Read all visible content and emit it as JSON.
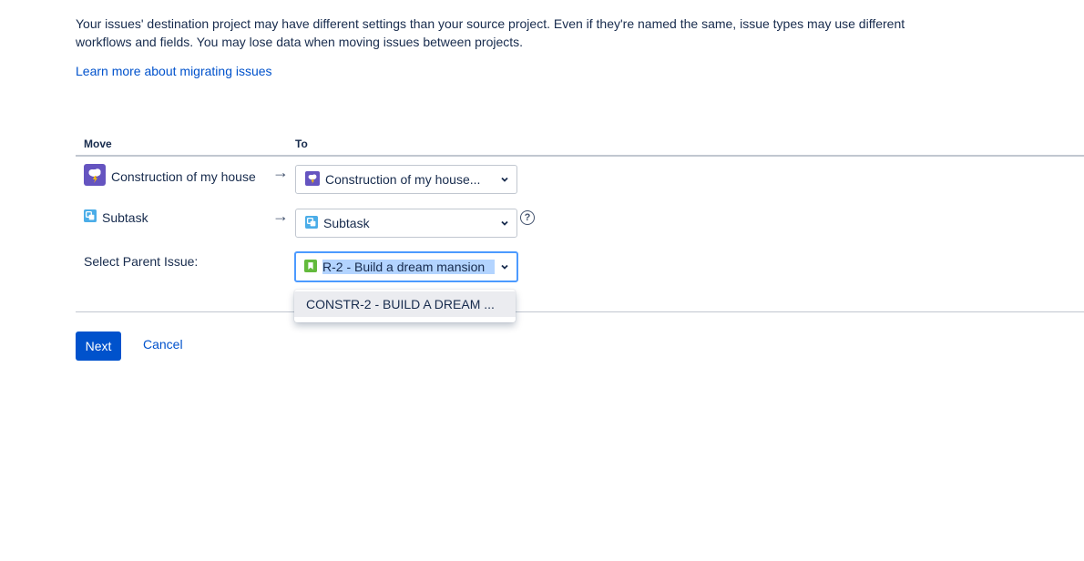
{
  "intro": {
    "text": "Your issues' destination project may have different settings than your source project. Even if they're named the same, issue types may use different workflows and fields. You may lose data when moving issues between projects.",
    "learn_more": "Learn more about migrating issues"
  },
  "table": {
    "col_move": "Move",
    "col_to": "To",
    "rows": [
      {
        "from_label": "Construction of my house",
        "icon": "project-storm-icon",
        "to_value": "Construction of my house..."
      },
      {
        "from_label": "Subtask",
        "icon": "subtask-icon",
        "to_value": "Subtask"
      }
    ],
    "parent_label": "Select Parent Issue:",
    "parent_value": "R-2 - Build a dream mansion",
    "parent_icon": "story-icon",
    "dropdown_option": "CONSTR-2 - BUILD A DREAM ..."
  },
  "actions": {
    "next": "Next",
    "cancel": "Cancel"
  },
  "colors": {
    "primary": "#0052cc",
    "focus": "#4c9aff",
    "selection": "#b3d4ff",
    "text": "#172b4d"
  }
}
